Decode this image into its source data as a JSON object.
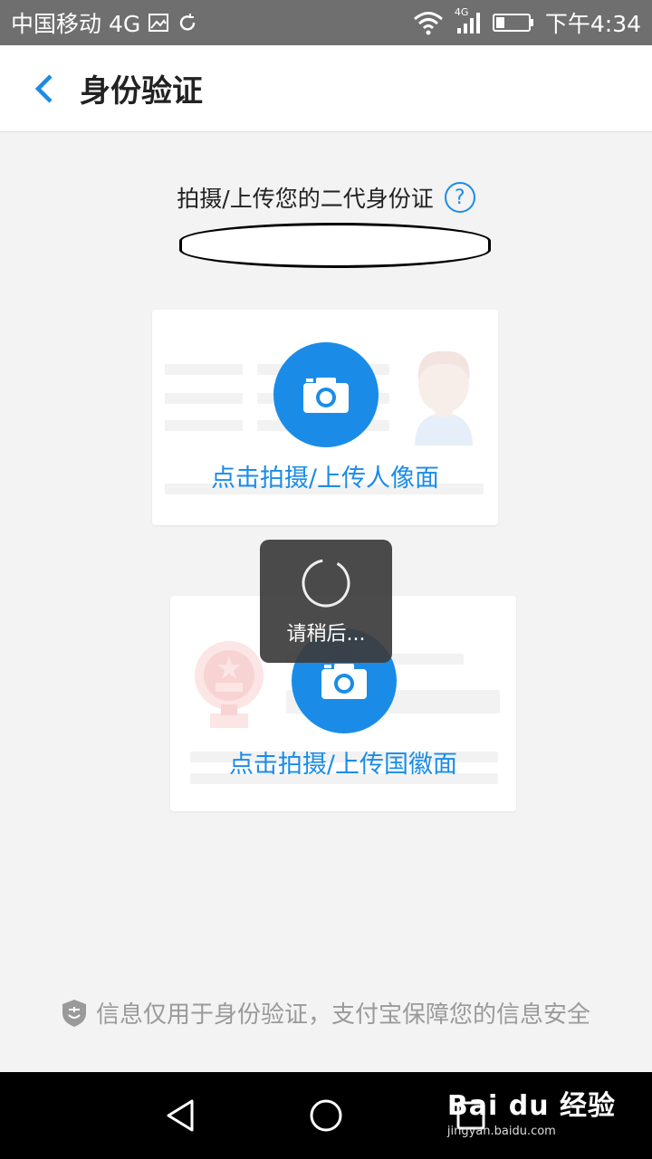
{
  "status_bar": {
    "carrier": "中国移动 4G",
    "network_small": "4G",
    "time": "下午4:34"
  },
  "header": {
    "title": "身份验证"
  },
  "prompt": {
    "text": "拍摄/上传您的二代身份证",
    "help_symbol": "?"
  },
  "cards": {
    "front_label": "点击拍摄/上传人像面",
    "back_label": "点击拍摄/上传国徽面"
  },
  "loading": {
    "text": "请稍后..."
  },
  "footer": {
    "notice": "信息仅用于身份验证，支付宝保障您的信息安全"
  },
  "watermark": {
    "logo": "Bai du 经验",
    "url": "jingyan.baidu.com"
  },
  "colors": {
    "accent": "#1a8ce8",
    "status_bar": "#6f6f6f",
    "background": "#f3f3f3",
    "toast": "#3c3c3c"
  },
  "icons": {
    "back": "chevron-left-icon",
    "help": "question-circle-icon",
    "camera": "camera-icon",
    "shield": "shield-icon",
    "nav_back": "triangle-back-icon",
    "nav_home": "circle-home-icon",
    "nav_recent": "square-recent-icon"
  }
}
